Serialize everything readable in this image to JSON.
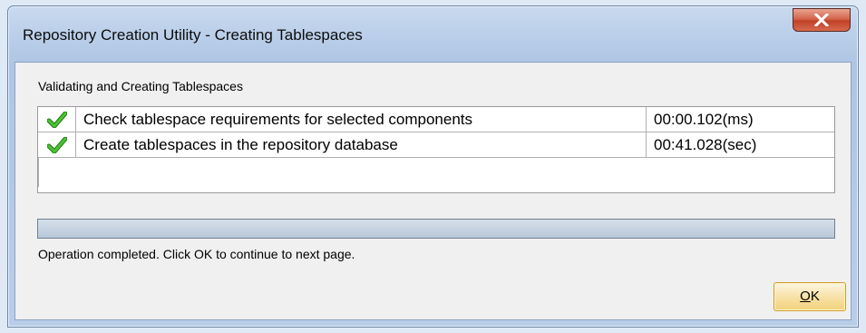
{
  "window": {
    "title": "Repository Creation Utility - Creating Tablespaces",
    "close_icon": "close-x-icon"
  },
  "section": {
    "label": "Validating and Creating Tablespaces"
  },
  "tasks": [
    {
      "status_icon": "green-checkmark-icon",
      "name": "Check tablespace requirements for selected components",
      "time": "00:00.102(ms)"
    },
    {
      "status_icon": "green-checkmark-icon",
      "name": "Create tablespaces in the repository database",
      "time": "00:41.028(sec)"
    }
  ],
  "progress": {
    "fraction": 1.0
  },
  "status": {
    "message": "Operation completed. Click OK to continue to next page."
  },
  "buttons": {
    "ok_mnemonic": "O",
    "ok_rest": "K"
  },
  "colors": {
    "check_green": "#2e9b1f",
    "close_red": "#c24127"
  }
}
